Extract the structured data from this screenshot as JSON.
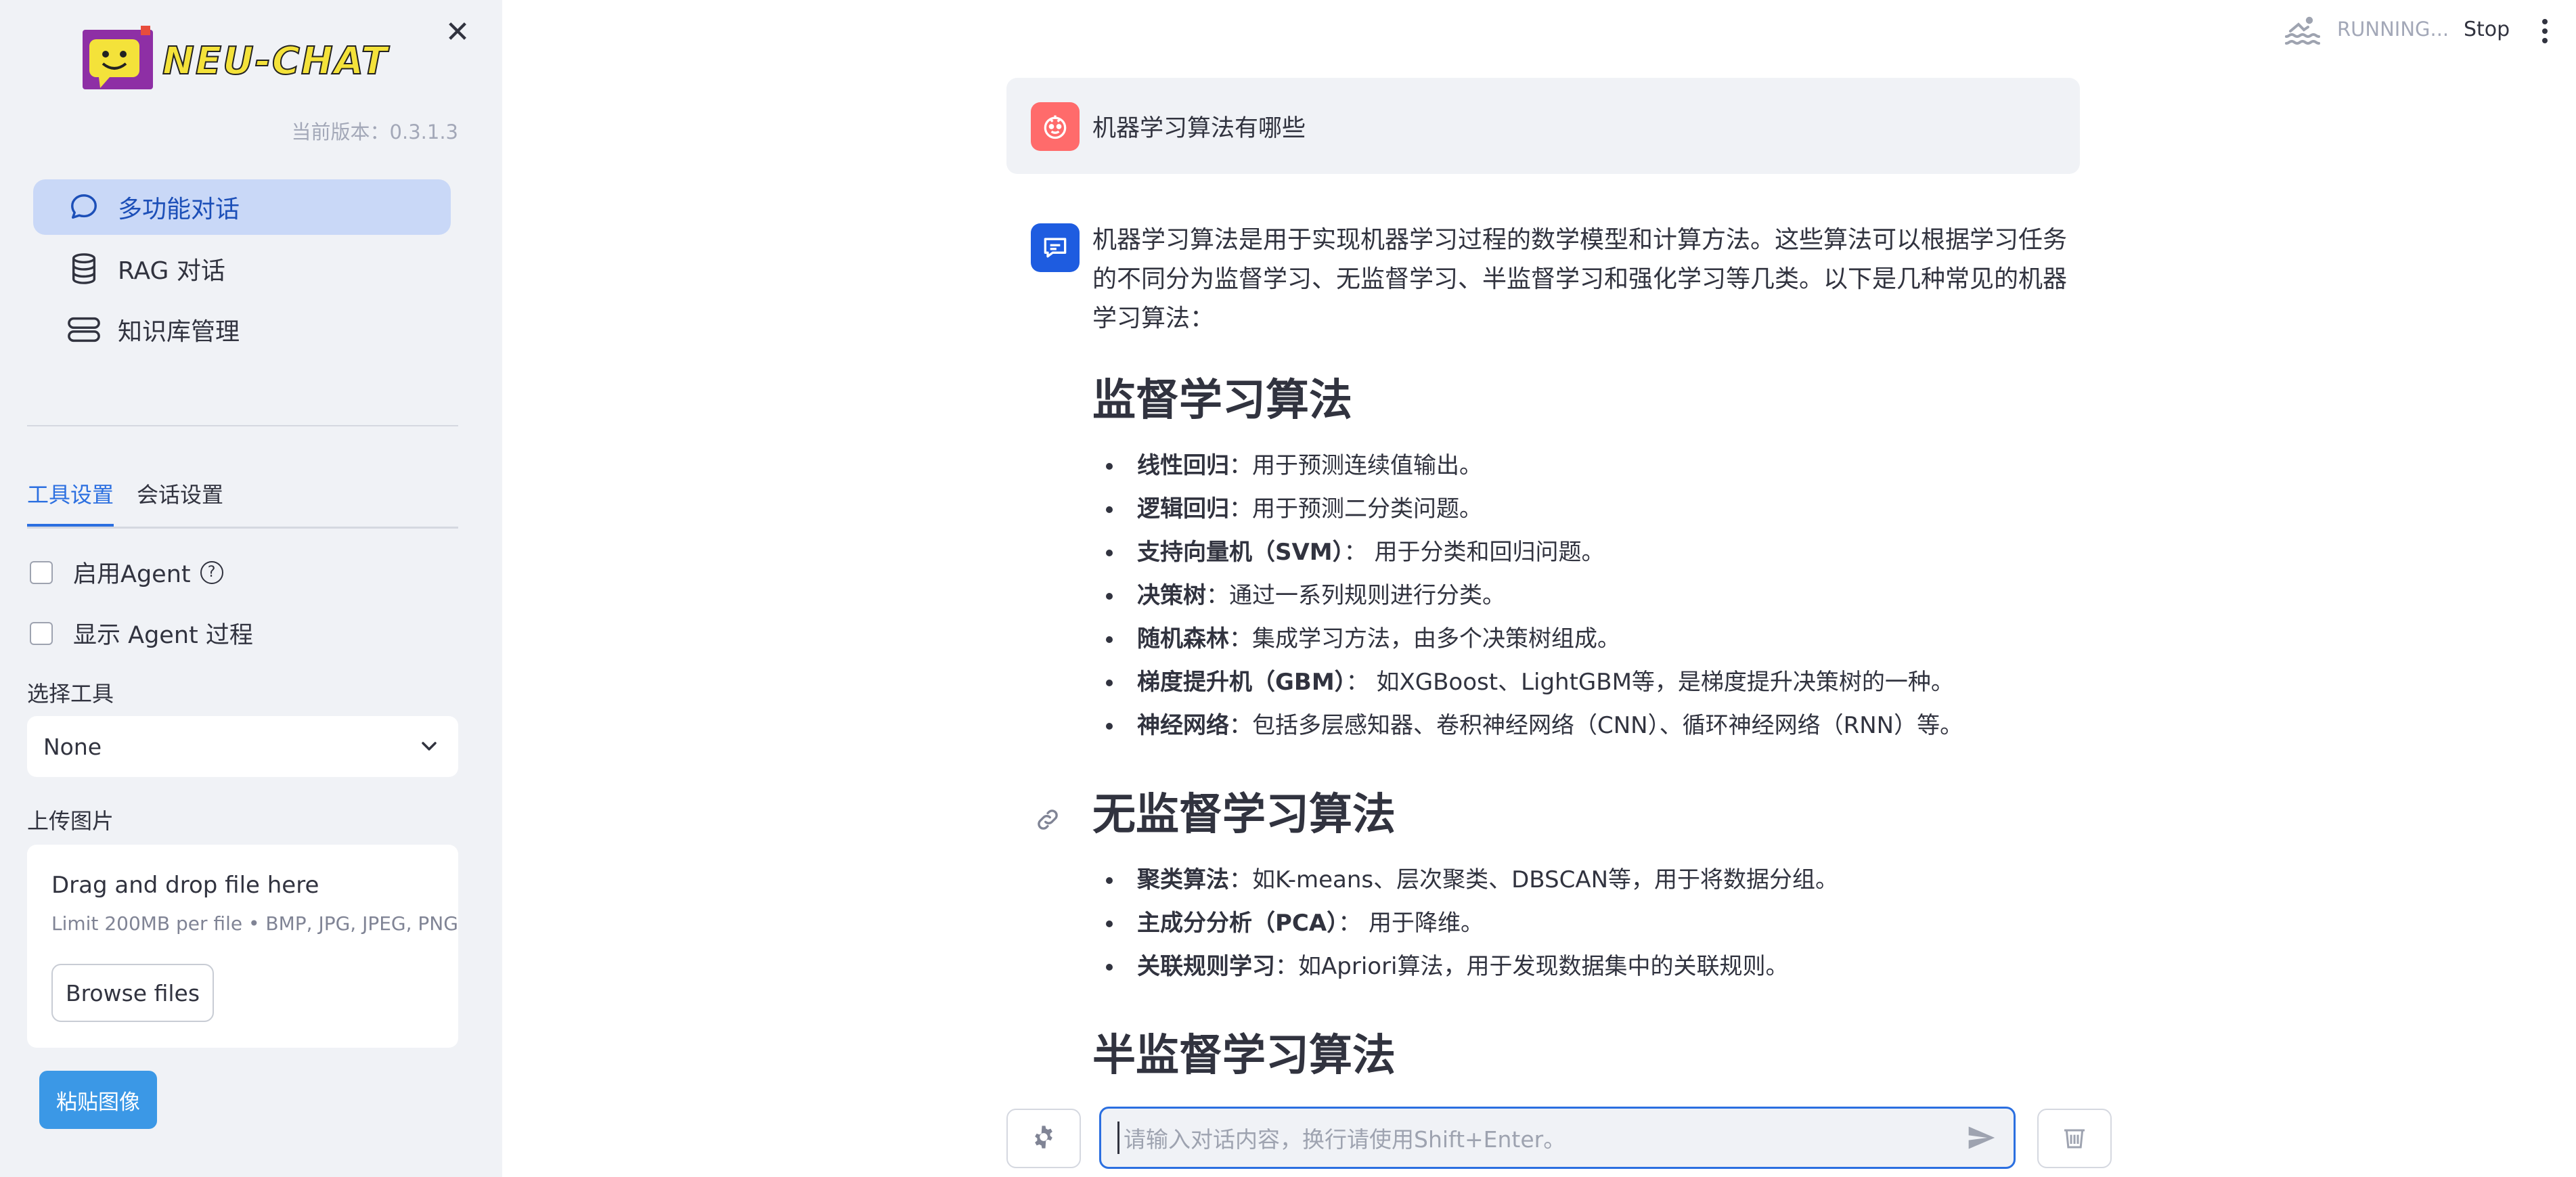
{
  "sidebar": {
    "logo_text": "NEU-CHAT",
    "version": "当前版本：0.3.1.3",
    "nav": [
      {
        "label": "多功能对话"
      },
      {
        "label": "RAG 对话"
      },
      {
        "label": "知识库管理"
      }
    ],
    "tabs": [
      {
        "label": "工具设置"
      },
      {
        "label": "会话设置"
      }
    ],
    "checkbox_agent": "启用Agent",
    "checkbox_agent_process": "显示 Agent 过程",
    "select_tool_label": "选择工具",
    "select_tool_value": "None",
    "upload_label": "上传图片",
    "dropzone_title": "Drag and drop file here",
    "dropzone_limit": "Limit 200MB per file • BMP, JPG, JPEG, PNG",
    "browse_button": "Browse files",
    "paste_button": "粘贴图像"
  },
  "topbar": {
    "status": "RUNNING...",
    "stop": "Stop"
  },
  "chat": {
    "user_message": "机器学习算法有哪些",
    "bot_intro": "机器学习算法是用于实现机器学习过程的数学模型和计算方法。这些算法可以根据学习任务的不同分为监督学习、无监督学习、半监督学习和强化学习等几类。以下是几种常见的机器学习算法：",
    "sections": [
      {
        "title": "监督学习算法",
        "items": [
          {
            "term": "线性回归",
            "desc": "：用于预测连续值输出。"
          },
          {
            "term": "逻辑回归",
            "desc": "：用于预测二分类问题。"
          },
          {
            "term": "支持向量机（SVM）",
            "desc": "： 用于分类和回归问题。"
          },
          {
            "term": "决策树",
            "desc": "：通过一系列规则进行分类。"
          },
          {
            "term": "随机森林",
            "desc": "：集成学习方法，由多个决策树组成。"
          },
          {
            "term": "梯度提升机（GBM）",
            "desc": "： 如XGBoost、LightGBM等，是梯度提升决策树的一种。"
          },
          {
            "term": "神经网络",
            "desc": "：包括多层感知器、卷积神经网络（CNN）、循环神经网络（RNN）等。"
          }
        ]
      },
      {
        "title": "无监督学习算法",
        "items": [
          {
            "term": "聚类算法",
            "desc": "：如K-means、层次聚类、DBSCAN等，用于将数据分组。"
          },
          {
            "term": "主成分分析（PCA）",
            "desc": "： 用于降维。"
          },
          {
            "term": "关联规则学习",
            "desc": "：如Apriori算法，用于发现数据集中的关联规则。"
          }
        ]
      },
      {
        "title": "半监督学习算法",
        "items": []
      }
    ],
    "input_placeholder": "请输入对话内容，换行请使用Shift+Enter。"
  },
  "colors": {
    "accent": "#2b6fe0",
    "nav_active_bg": "#c9d8f7",
    "user_avatar": "#ff6b6b",
    "bot_avatar": "#1e5ce0",
    "paste_button": "#3b98e6"
  },
  "icons": {
    "sidebar_close": "close-icon",
    "nav_1": "chat-bubble-icon",
    "nav_2": "database-icon",
    "nav_3": "server-stack-icon",
    "help": "question-circle-icon",
    "select_chevron": "chevron-down-icon",
    "running": "swimmer-icon",
    "menu": "more-vertical-icon",
    "user_avatar": "face-icon",
    "bot_avatar": "message-icon",
    "anchor": "link-icon",
    "settings": "gear-icon",
    "send": "send-icon",
    "clear": "trash-icon"
  }
}
